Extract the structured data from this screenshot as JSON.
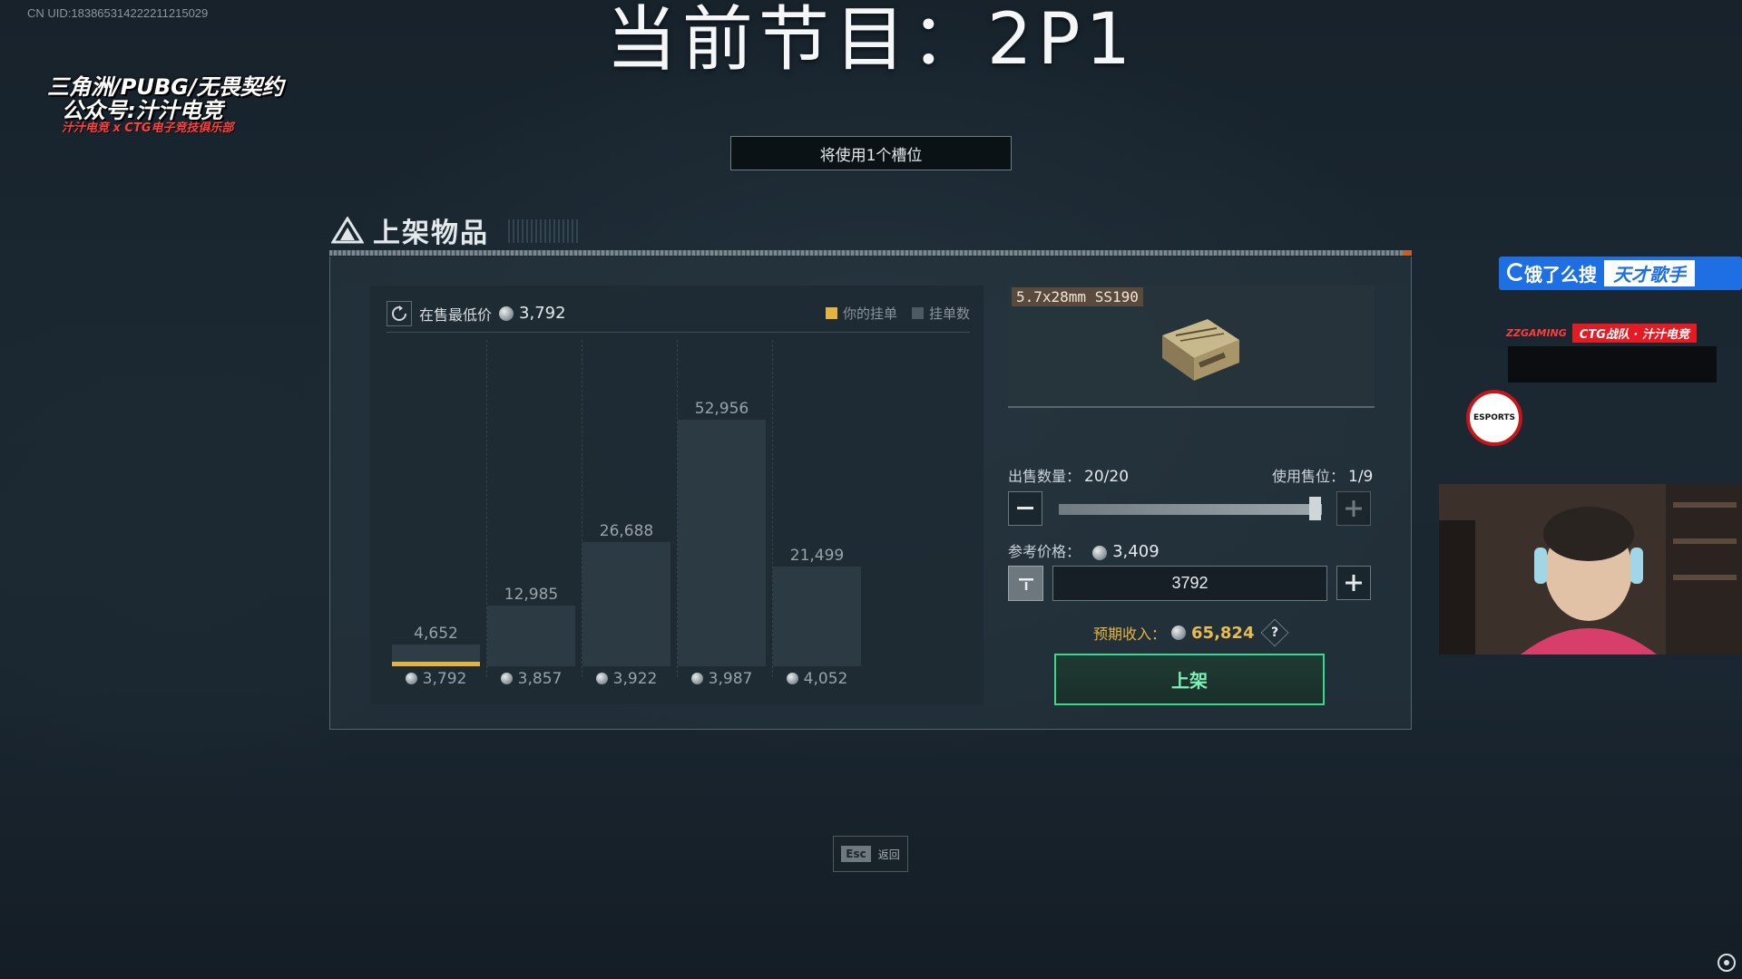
{
  "overlay": {
    "uid": "CN UID:183865314222211215029",
    "program_title": "当前节目：2P1"
  },
  "dialog": {
    "slot_notice": "将使用1个槽位",
    "section_title": "上架物品",
    "chart": {
      "lowest_price_label": "在售最低价",
      "lowest_price_value": "3,792",
      "legend": {
        "your_listing": "你的挂单",
        "listing_count": "挂单数"
      },
      "bars": [
        {
          "count": "4,652",
          "price": "3,792"
        },
        {
          "count": "12,985",
          "price": "3,857"
        },
        {
          "count": "26,688",
          "price": "3,922"
        },
        {
          "count": "52,956",
          "price": "3,987"
        },
        {
          "count": "21,499",
          "price": "4,052"
        }
      ]
    },
    "item": {
      "name": "5.7x28mm SS190"
    },
    "quantity": {
      "label": "出售数量：",
      "value": "20/20",
      "fraction": 1.0
    },
    "slots": {
      "label": "使用售位：",
      "value": "1/9"
    },
    "reference_price": {
      "label": "参考价格：",
      "value": "3,409"
    },
    "price_input": {
      "value": "3792"
    },
    "income": {
      "label": "预期收入：",
      "value": "65,824"
    },
    "list_button": "上架",
    "esc": {
      "key": "Esc",
      "label": "返回"
    }
  },
  "ads": {
    "search_banner": "饿了么搜",
    "search_tag": "天才歌手",
    "sponsor_top_left": "ZZGAMING",
    "sponsor_top_right": "CTG战队 · 汁汁电竞",
    "sponsor_line1": "三角洲/PUBG/无畏契约",
    "sponsor_line2": "公众号:汁汁电竞",
    "sponsor_line3": "汁汁电竞 x CTG电子竞技俱乐部",
    "sponsor_badge": "ESPORTS"
  },
  "colors": {
    "accent_yellow": "#e4b53e",
    "confirm_green": "#37d98a",
    "bar_fill": "#2c3a43"
  }
}
